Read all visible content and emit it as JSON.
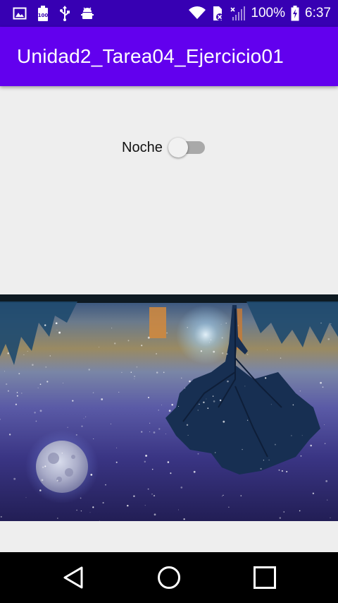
{
  "status_bar": {
    "battery_percent": "100%",
    "time": "6:37",
    "icons_left": [
      "gallery-icon",
      "battery-100-icon",
      "usb-icon",
      "android-debug-icon"
    ],
    "icons_right": [
      "wifi-icon",
      "no-sim-icon",
      "signal-icon",
      "battery-charging-icon"
    ]
  },
  "app_bar": {
    "title": "Unidad2_Tarea04_Ejercicio01"
  },
  "night_switch": {
    "label": "Noche",
    "checked": false
  },
  "scene_image": {
    "icon": "night-sky-reflection-image"
  },
  "nav_bar": {
    "buttons": [
      "back-icon",
      "home-icon",
      "recents-icon"
    ]
  },
  "colors": {
    "status_bar": "#3700b3",
    "app_bar": "#6200ee",
    "background": "#eeeeee",
    "switch_track_off": "#a9a9a9",
    "switch_thumb_off": "#f1f1f1",
    "nav_bar": "#000000"
  }
}
